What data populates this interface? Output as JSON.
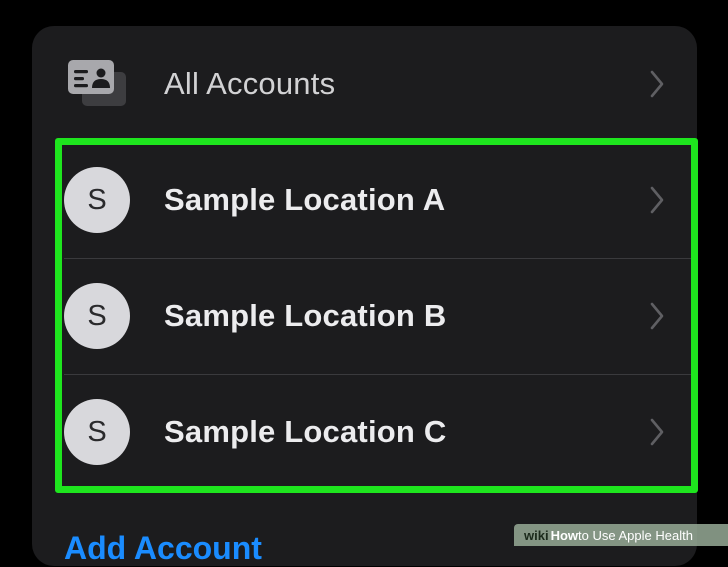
{
  "all_accounts": {
    "label": "All Accounts",
    "icon": "id-card-stack-icon"
  },
  "locations": [
    {
      "initial": "S",
      "label": "Sample Location A"
    },
    {
      "initial": "S",
      "label": "Sample Location B"
    },
    {
      "initial": "S",
      "label": "Sample Location C"
    }
  ],
  "add_account": {
    "label": "Add Account"
  },
  "watermark": {
    "brand": "wiki",
    "how": "How",
    "rest": " to Use Apple Health"
  },
  "colors": {
    "background": "#000000",
    "card": "#1c1c1e",
    "highlight": "#1ee51e",
    "link": "#1a8cff",
    "avatar": "#d8d8dc"
  }
}
